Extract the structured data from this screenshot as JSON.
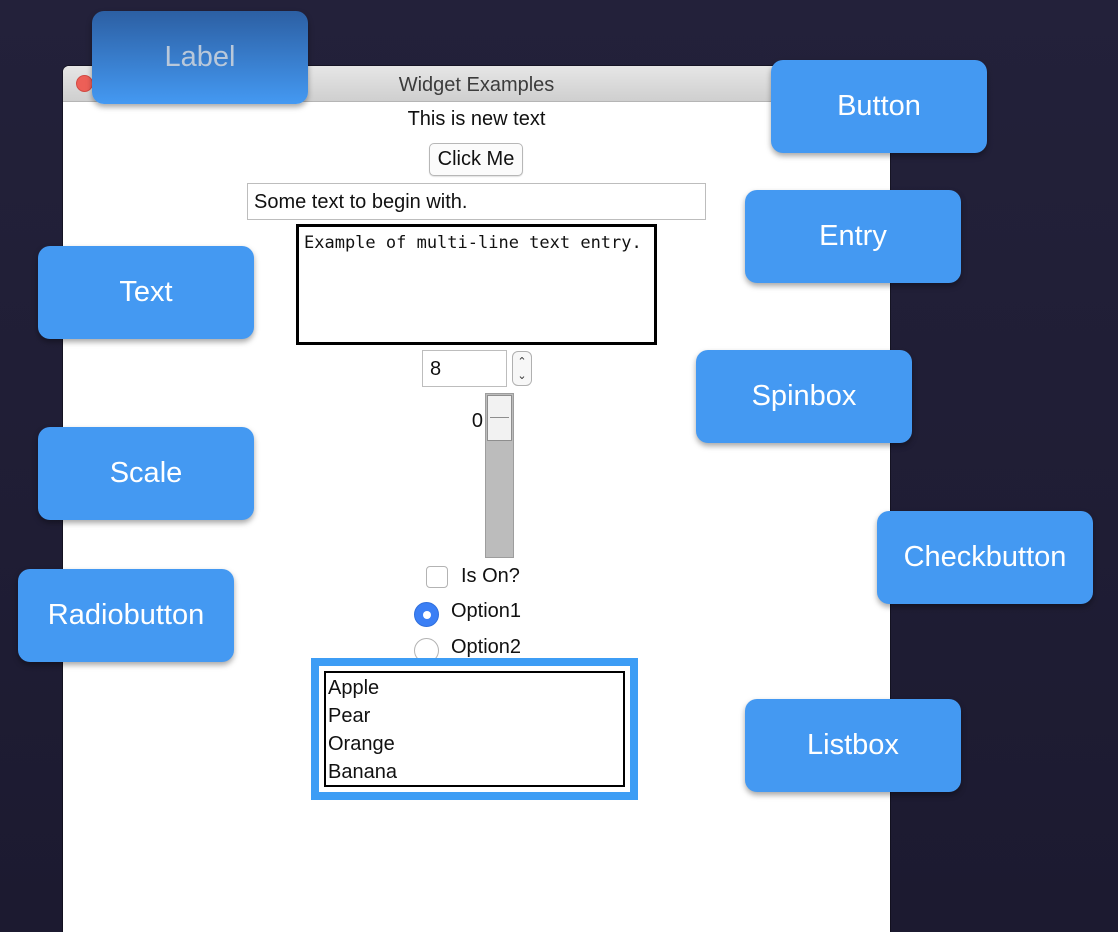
{
  "window": {
    "title": "Widget Examples"
  },
  "widgets": {
    "label_text": "This is new text",
    "button_label": "Click Me",
    "entry_value": "Some text to begin with.",
    "text_value": "Example of multi-line text entry.",
    "spinbox_value": "8",
    "spinbox_arrows": {
      "up": "⌃",
      "down": "⌄"
    },
    "scale_value": "0",
    "checkbutton_label": "Is On?",
    "checkbutton_checked": false,
    "radio_options": [
      {
        "label": "Option1",
        "selected": true
      },
      {
        "label": "Option2",
        "selected": false
      }
    ],
    "listbox_items": [
      "Apple",
      "Pear",
      "Orange",
      "Banana"
    ]
  },
  "callouts": {
    "label": "Label",
    "button": "Button",
    "entry": "Entry",
    "text": "Text",
    "spinbox": "Spinbox",
    "scale": "Scale",
    "checkbutton": "Checkbutton",
    "radiobutton": "Radiobutton",
    "listbox": "Listbox"
  },
  "colors": {
    "callout_bg": "#4499f2",
    "radio_selected": "#3b7ff5",
    "listbox_focus": "#3d9df5",
    "close_button": "#ed5f57",
    "background": "#23213a"
  },
  "icons": {
    "close": "close-icon",
    "spin_up": "chevron-up-icon",
    "spin_down": "chevron-down-icon"
  }
}
